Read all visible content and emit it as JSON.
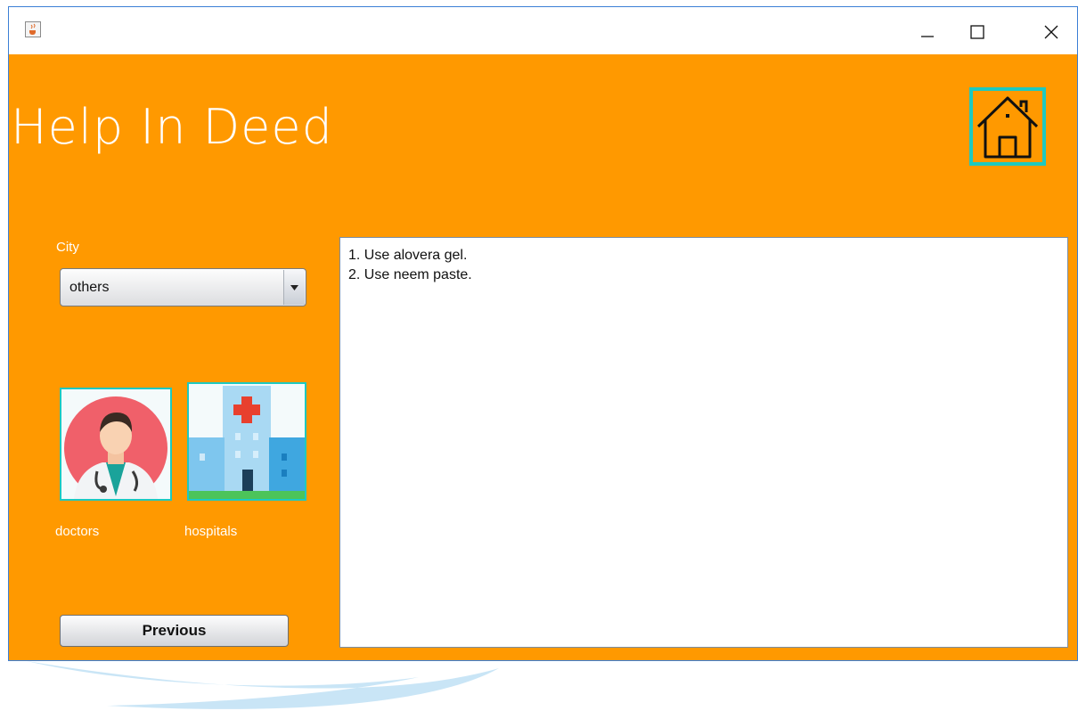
{
  "window": {
    "minimize_icon": "minimize-icon",
    "maximize_icon": "maximize-icon",
    "close_icon": "close-icon",
    "app_icon": "java-cup-icon"
  },
  "header": {
    "title": "Help In Deed",
    "home_icon": "home-icon"
  },
  "city": {
    "label": "City",
    "selected": "others"
  },
  "services": [
    {
      "caption": "doctors",
      "icon": "doctor-icon"
    },
    {
      "caption": "hospitals",
      "icon": "hospital-icon"
    }
  ],
  "info": {
    "lines": [
      "1. Use alovera gel.",
      "2. Use neem paste."
    ]
  },
  "actions": {
    "previous_label": "Previous"
  },
  "colors": {
    "background": "#ff9900",
    "accent_border": "#1ec9c0",
    "text_light": "#ffffff"
  }
}
